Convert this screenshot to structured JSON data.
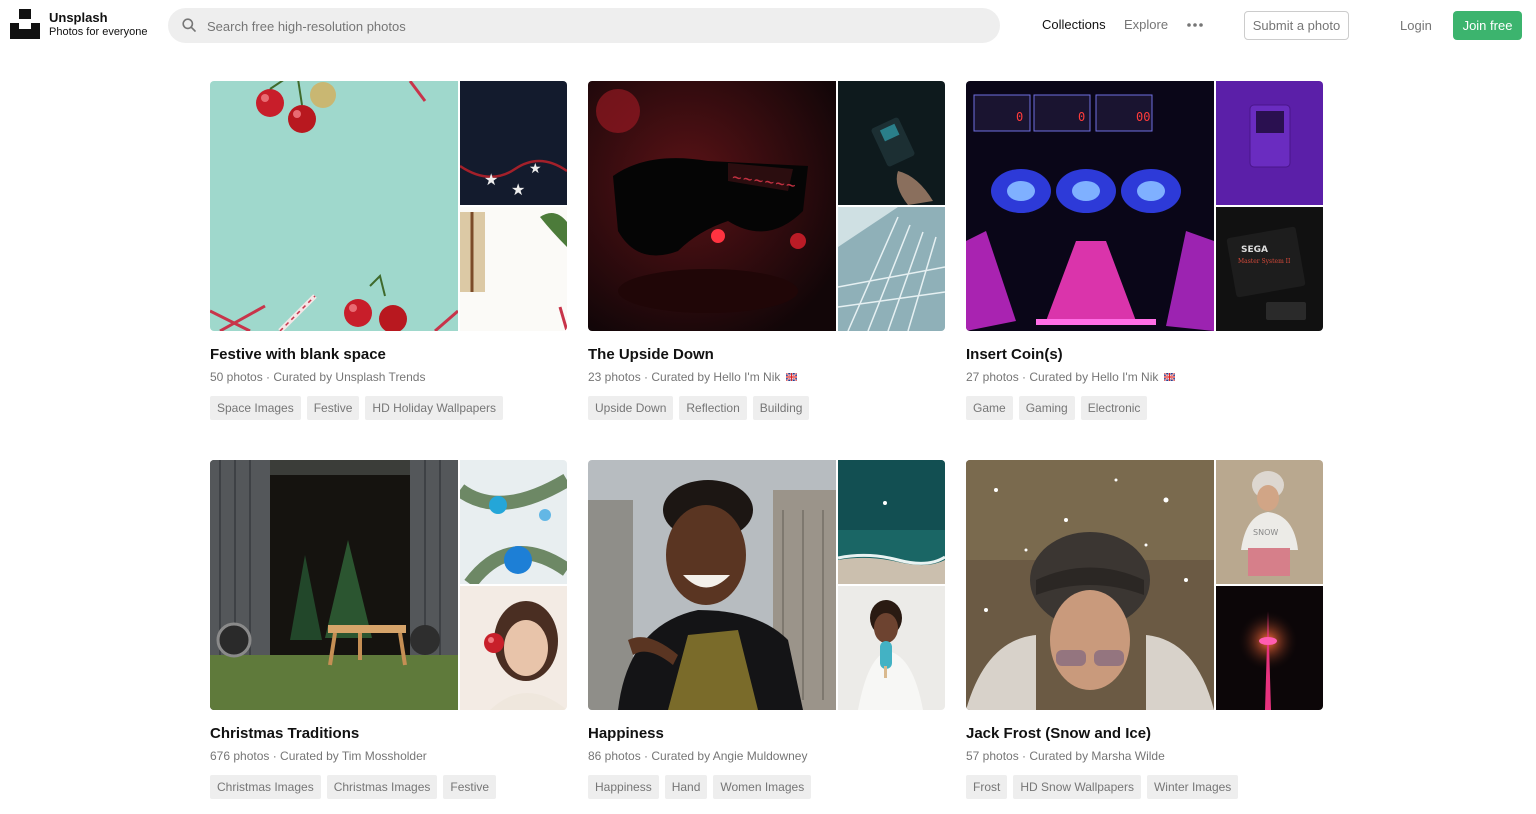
{
  "header": {
    "brand_name": "Unsplash",
    "brand_tagline": "Photos for everyone",
    "search_placeholder": "Search free high-resolution photos",
    "nav": {
      "collections": "Collections",
      "explore": "Explore",
      "submit": "Submit a photo",
      "login": "Login",
      "join": "Join free"
    },
    "accent_color": "#3cb46e"
  },
  "collections": [
    {
      "title": "Festive with blank space",
      "meta": "50 photos · Curated by Unsplash Trends",
      "tags": [
        "Space Images",
        "Festive",
        "HD Holiday Wallpapers"
      ]
    },
    {
      "title": "The Upside Down",
      "meta": "23 photos · Curated by Hello I'm Nik",
      "tags": [
        "Upside Down",
        "Reflection",
        "Building"
      ]
    },
    {
      "title": "Insert Coin(s)",
      "meta": "27 photos · Curated by Hello I'm Nik",
      "tags": [
        "Game",
        "Gaming",
        "Electronic"
      ]
    },
    {
      "title": "Christmas Traditions",
      "meta": "676 photos · Curated by Tim Mossholder",
      "tags": [
        "Christmas Images",
        "Christmas Images",
        "Festive"
      ]
    },
    {
      "title": "Happiness",
      "meta": "86 photos · Curated by Angie Muldowney",
      "tags": [
        "Happiness",
        "Hand",
        "Women Images"
      ]
    },
    {
      "title": "Jack Frost (Snow and Ice)",
      "meta": "57 photos · Curated by Marsha Wilde",
      "tags": [
        "Frost",
        "HD Snow Wallpapers",
        "Winter Images"
      ]
    }
  ]
}
